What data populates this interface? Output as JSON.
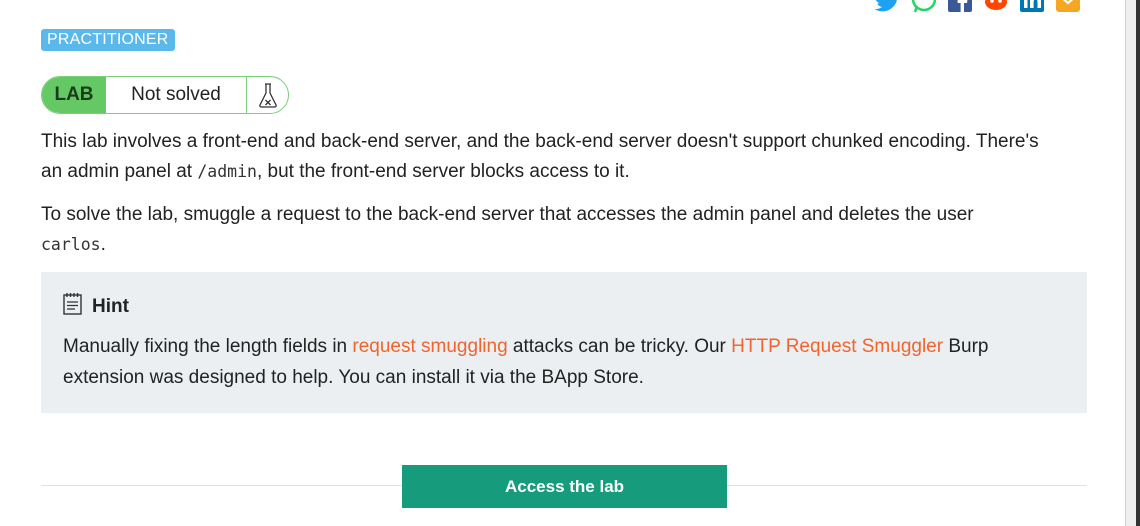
{
  "level_badge": "PRACTITIONER",
  "status": {
    "lab_label": "LAB",
    "state": "Not solved"
  },
  "description": {
    "p1_before": "This lab involves a front-end and back-end server, and the back-end server doesn't support chunked encoding. There's an admin panel at ",
    "p1_code": "/admin",
    "p1_after": ", but the front-end server blocks access to it.",
    "p2_before": "To solve the lab, smuggle a request to the back-end server that accesses the admin panel and deletes the user ",
    "p2_code": "carlos",
    "p2_after": "."
  },
  "hint": {
    "title": "Hint",
    "text_1": "Manually fixing the length fields in ",
    "link_1": "request smuggling",
    "text_2": " attacks can be tricky. Our ",
    "link_2": "HTTP Request Smuggler",
    "text_3": " Burp extension was designed to help. You can install it via the BApp Store."
  },
  "cta": {
    "label": "Access the lab"
  },
  "share_icons": [
    "twitter-icon",
    "whatsapp-icon",
    "facebook-icon",
    "reddit-icon",
    "linkedin-icon",
    "email-icon"
  ],
  "colors": {
    "badge": "#5ab8ea",
    "lab_green": "#64c864",
    "link": "#f0642e",
    "button": "#169c7c",
    "hint_bg": "#ebeff1"
  }
}
